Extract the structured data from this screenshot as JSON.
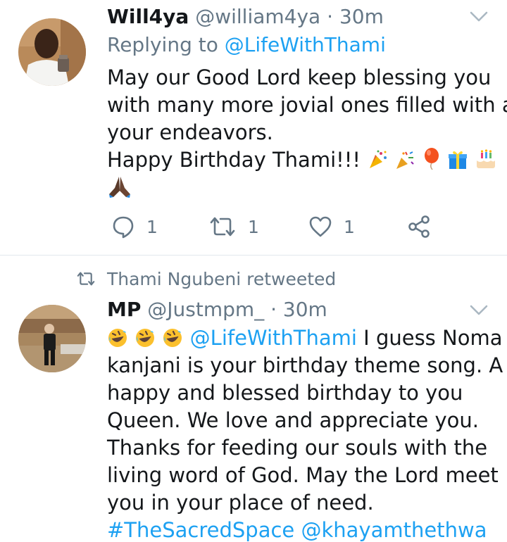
{
  "tweets": [
    {
      "author": {
        "name": "Will4ya",
        "handle": "@william4ya"
      },
      "separator": "·",
      "time": "30m",
      "replying_label": "Replying to",
      "replying_to": "@LifeWithThami",
      "body_lines": [
        "May our Good Lord keep blessing you",
        "with many more jovial ones filled with all",
        "your endeavors.",
        "Happy Birthday Thami!!!"
      ],
      "emojis_line1": [
        "party-popper-emoji",
        "confetti-emoji",
        "balloon-emoji",
        "gift-emoji",
        "birthday-cake-emoji"
      ],
      "emojis_line2": [
        "folded-hands-emoji"
      ],
      "actions": {
        "replies": "1",
        "retweets": "1",
        "likes": "1"
      },
      "colors": {
        "link": "#1da1f2",
        "muted": "#657786"
      }
    },
    {
      "retweeted_by": "Thami Ngubeni retweeted",
      "author": {
        "name": "MP",
        "handle": "@Justmpm_"
      },
      "separator": "·",
      "time": "30m",
      "leading_emojis": [
        "rolling-laughing-emoji",
        "rolling-laughing-emoji",
        "rolling-laughing-emoji"
      ],
      "mention": "@LifeWithThami",
      "first_line_rest": "I guess Noma",
      "body_lines": [
        "kanjani is your birthday theme song. A",
        "happy and blessed birthday to you",
        "Queen. We love and appreciate you.",
        "Thanks for feeding our souls with the",
        "living word of God. May the Lord meet",
        "you in your place of need."
      ],
      "hashtag": "#TheSacredSpace",
      "mention2": "@khayamthethwa"
    }
  ]
}
